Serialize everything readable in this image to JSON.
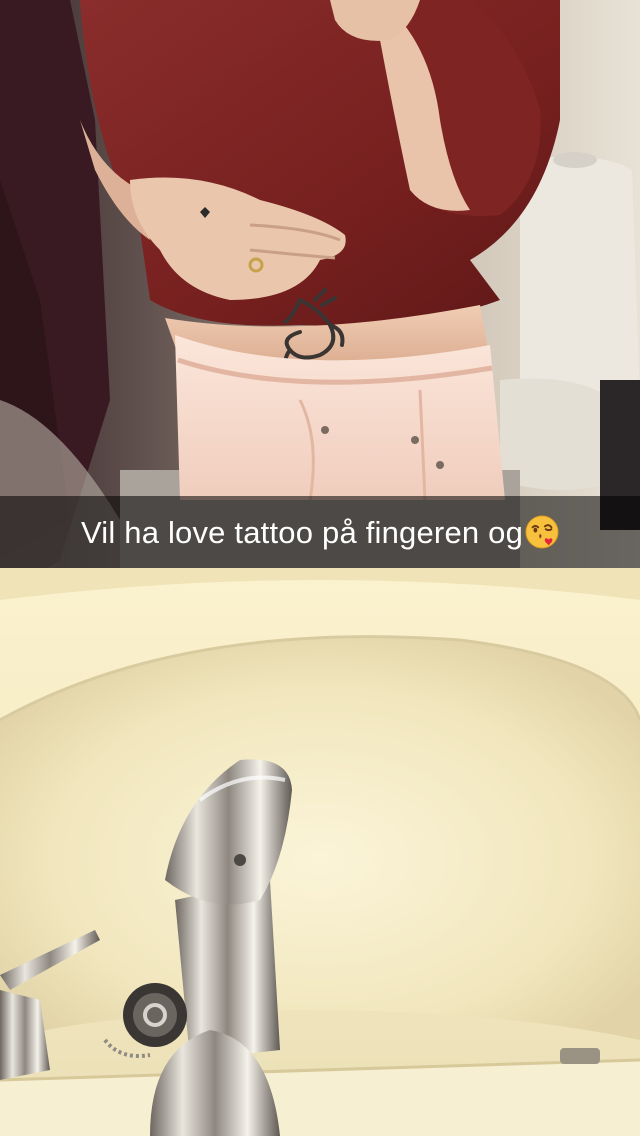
{
  "snap": {
    "caption": "Vil ha love tattoo på fingeren og",
    "caption_emoji": "face-throwing-kiss-icon"
  },
  "colors": {
    "caption_bar": "#000000",
    "caption_text": "#ffffff",
    "sweater": "#7a2526",
    "jeans": "#f3d6c8",
    "sink": "#f4ecc8"
  }
}
